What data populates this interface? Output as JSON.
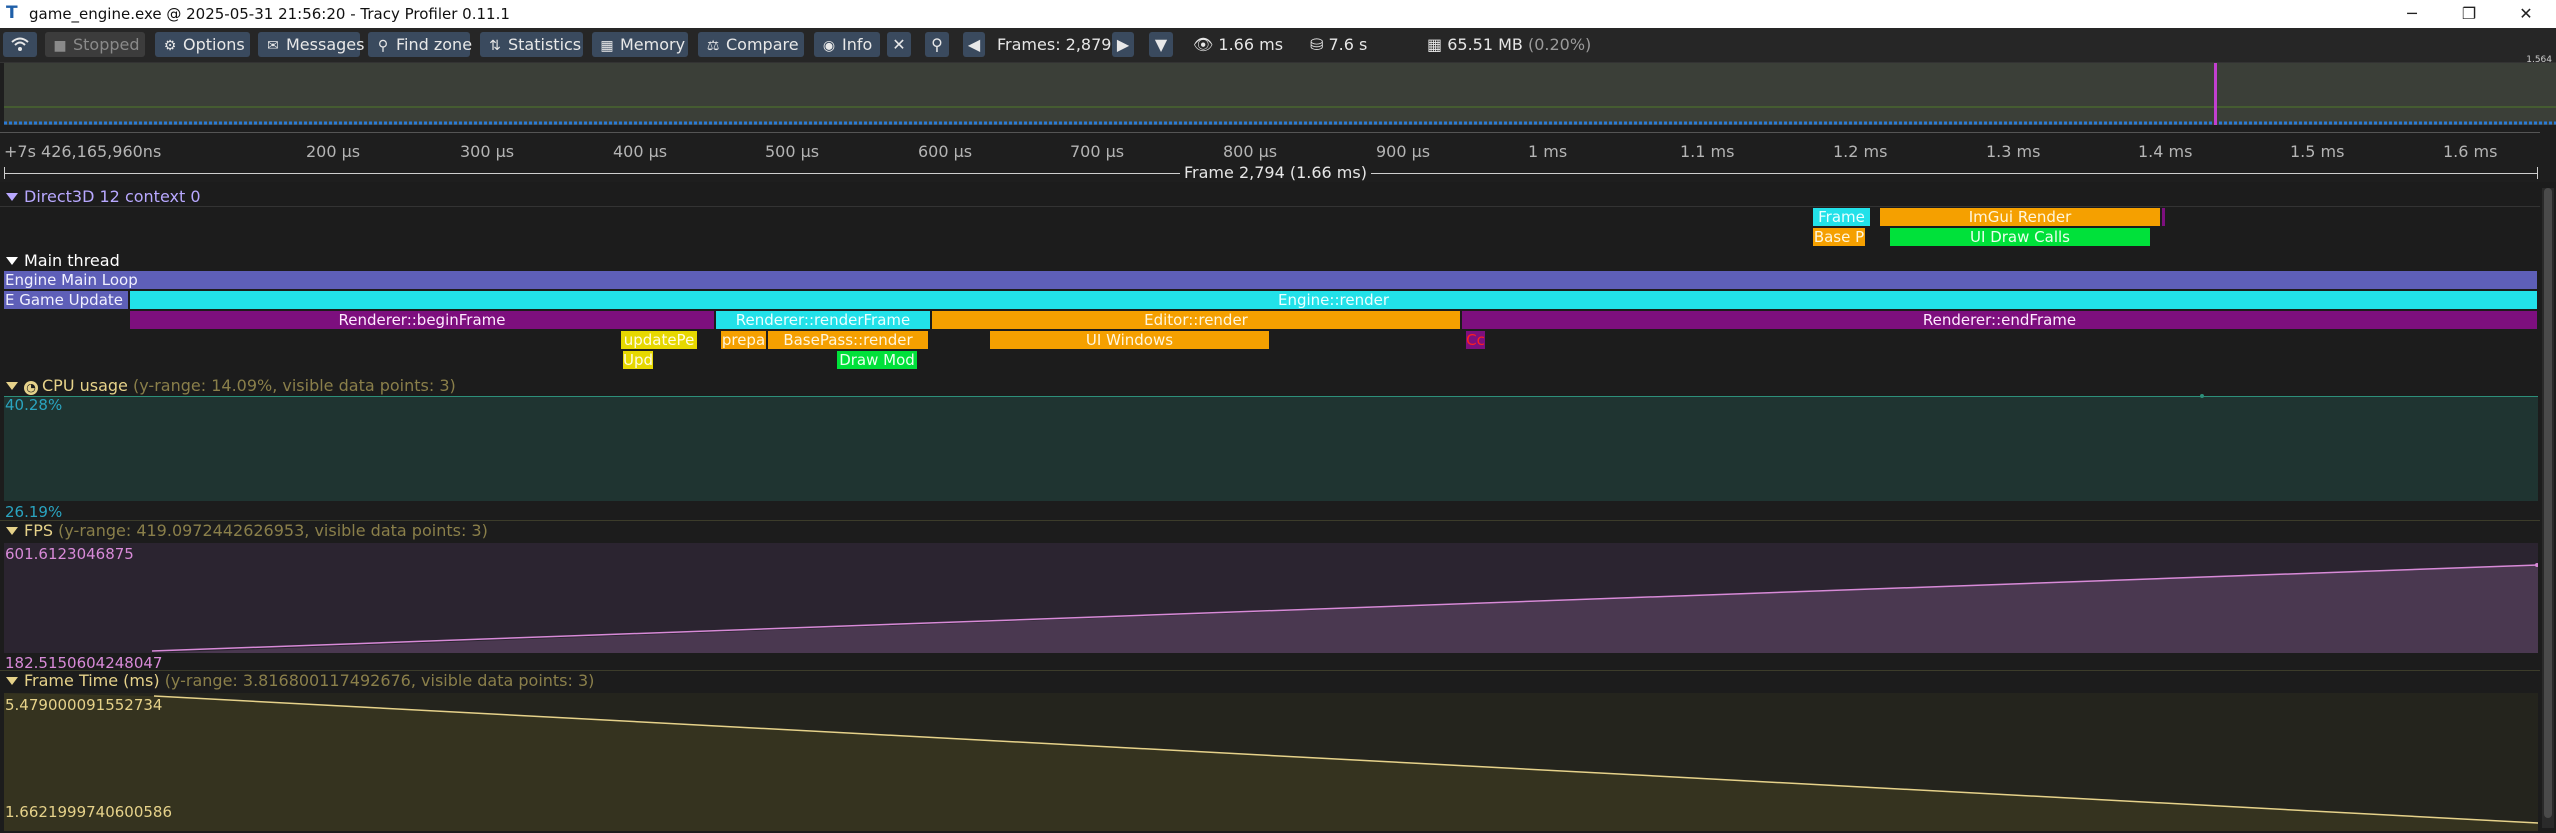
{
  "window": {
    "title": "game_engine.exe @ 2025-05-31 21:56:20 - Tracy Profiler 0.11.1",
    "app_icon": "T",
    "minimize_glyph": "─",
    "maximize_glyph": "❐",
    "close_glyph": "✕"
  },
  "toolbar": {
    "connection_icon": "wifi-icon",
    "stopped_label": "Stopped",
    "options_label": "Options",
    "messages_label": "Messages",
    "find_zone_label": "Find zone",
    "statistics_label": "Statistics",
    "memory_label": "Memory",
    "compare_label": "Compare",
    "info_label": "Info",
    "frames_label": "Frames: 2,879",
    "frame_time": "1.66 ms",
    "total_time": "7.6 s",
    "memory_usage": "65.51 MB",
    "memory_percent": "(0.20%)"
  },
  "overview": {
    "corner_label": "1.564"
  },
  "ruler": {
    "start_label": "+7s 426,165,960ns",
    "ticks": [
      "200 μs",
      "300 μs",
      "400 μs",
      "500 μs",
      "600 μs",
      "700 μs",
      "800 μs",
      "900 μs",
      "1 ms",
      "1.1 ms",
      "1.2 ms",
      "1.3 ms",
      "1.4 ms",
      "1.5 ms",
      "1.6 ms"
    ],
    "frame_label": "Frame 2,794 (1.66 ms)"
  },
  "gpu": {
    "header": "Direct3D 12 context 0",
    "zones": [
      "Frame",
      "ImGui Render",
      "Base P",
      "UI Draw Calls"
    ]
  },
  "main_thread": {
    "header": "Main thread",
    "zones": {
      "engine_main_loop": "Engine Main Loop",
      "game_update": "E Game Update",
      "engine_render": "Engine::render",
      "begin_frame": "Renderer::beginFrame",
      "render_frame": "Renderer::renderFrame",
      "editor_render": "Editor::render",
      "end_frame": "Renderer::endFrame",
      "update_pe": "updatePe",
      "prepa": "prepa",
      "base_pass": "BasePass::render",
      "ui_windows": "UI Windows",
      "cc": "Cc",
      "upd": "Upd",
      "draw_mod": "Draw Mod"
    }
  },
  "plots": {
    "cpu": {
      "title": "CPU usage",
      "info": "(y-range: 14.09%, visible data points: 3)",
      "max_label": "40.28%",
      "min_label": "26.19%"
    },
    "fps": {
      "title": "FPS",
      "info": "(y-range: 419.0972442626953, visible data points: 3)",
      "max_label": "601.6123046875",
      "min_label": "182.5150604248047"
    },
    "frame_time": {
      "title": "Frame Time (ms)",
      "info": "(y-range: 3.816800117492676, visible data points: 3)",
      "max_label": "5.479000091552734",
      "min_label": "1.6621999740600586"
    }
  },
  "colors": {
    "toolbar_button": "#3a4a5e",
    "zone_cyan": "#22e1e9",
    "zone_orange": "#f5a000",
    "zone_purple": "#7d0f7e",
    "zone_yellow": "#e6d800",
    "zone_green": "#00e13a",
    "zone_main_loop": "#5e5fb8",
    "cpu_plot": "#1f3431",
    "fps_plot": "#3a2b3a",
    "frame_time_plot": "#2e2d24"
  }
}
